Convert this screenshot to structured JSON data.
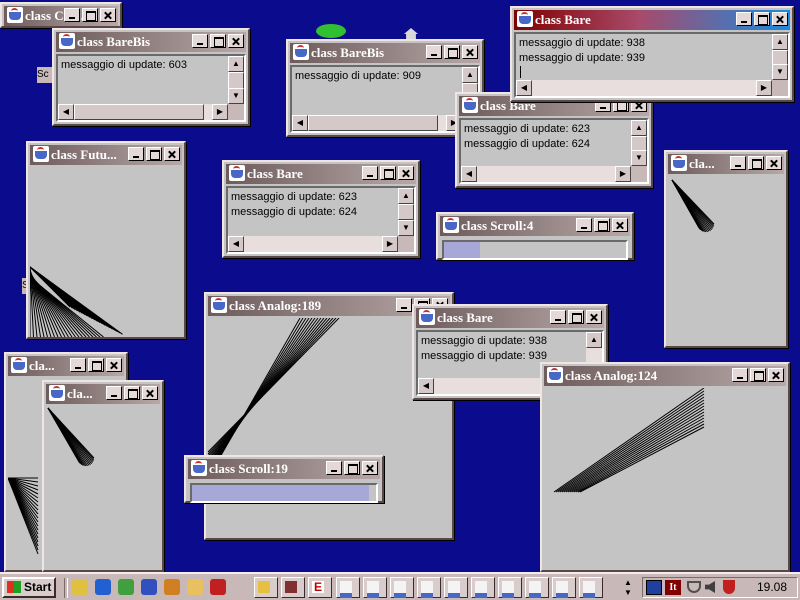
{
  "windows": {
    "counter": {
      "title": "class Cou..."
    },
    "barebis1": {
      "title": "class BareBis",
      "lines": [
        "messaggio di update: 603"
      ]
    },
    "barebis2": {
      "title": "class BareBis",
      "lines": [
        "messaggio di update: 909"
      ]
    },
    "bare_active": {
      "title": "class Bare",
      "lines": [
        "messaggio di update: 938",
        "messaggio di update: 939"
      ]
    },
    "bare_behind": {
      "title": "class Bare",
      "lines": [
        "messaggio di update: 623",
        "messaggio di update: 624"
      ]
    },
    "future": {
      "title": "class Futu..."
    },
    "bare_center": {
      "title": "class Bare",
      "lines": [
        "messaggio di update: 623",
        "messaggio di update: 624"
      ]
    },
    "scroll4": {
      "title": "class Scroll:4",
      "progress": 0.2
    },
    "right_small": {
      "title": "cla..."
    },
    "analog189": {
      "title": "class Analog:189"
    },
    "bare_mid": {
      "title": "class Bare",
      "lines": [
        "messaggio di update: 938",
        "messaggio di update: 939"
      ]
    },
    "analog124": {
      "title": "class Analog:124"
    },
    "left_small1": {
      "title": "cla..."
    },
    "left_small2": {
      "title": "cla..."
    },
    "scroll19": {
      "title": "class Scroll:19",
      "progress": 0.96
    }
  },
  "desktop_fragments": {
    "sc": "Sc",
    "s": "S"
  },
  "taskbar": {
    "start_label": "Start",
    "quick_launch": [
      "mail-icon",
      "ie-icon",
      "edit-icon",
      "channel-icon",
      "spark-icon",
      "files-icon",
      "sound-icon"
    ],
    "task_buttons": 13,
    "tray": {
      "lang": "It",
      "clock": "19.08"
    }
  },
  "colors": {
    "desktop": "#0b0b8e",
    "titlebar_inactive": "#8a7878",
    "titlebar_active_left": "#800000",
    "titlebar_active_right": "#1a8ae0",
    "taskbar": "#c8b8b8"
  }
}
